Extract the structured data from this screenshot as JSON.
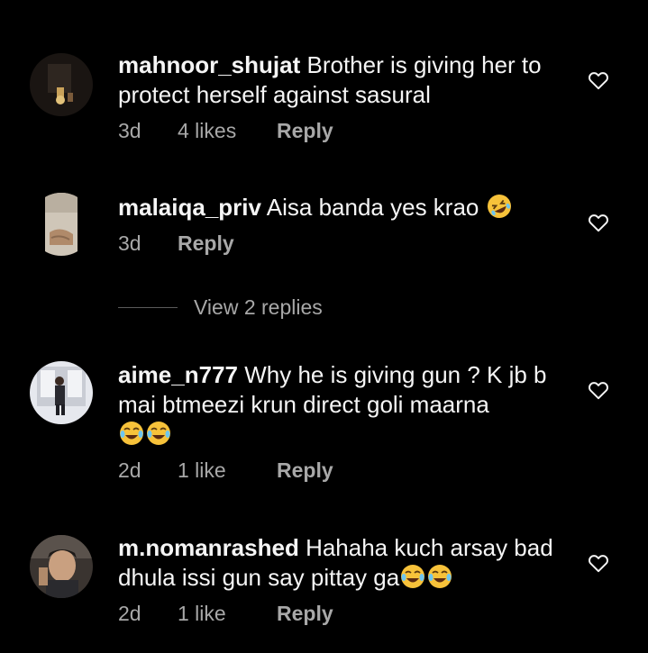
{
  "comments": [
    {
      "username": "mahnoor_shujat",
      "text": "Brother is giving her to protect herself against sasural",
      "time": "3d",
      "likes": "4 likes",
      "reply": "Reply"
    },
    {
      "username": "malaiqa_priv",
      "text": "Aisa banda yes krao",
      "time": "3d",
      "likes": "",
      "reply": "Reply",
      "emoji": "rolling-on-floor-laughing"
    },
    {
      "username": "aime_n777",
      "text": "Why he is giving gun ? K jb b mai btmeezi krun direct goli maarna",
      "time": "2d",
      "likes": "1 like",
      "reply": "Reply",
      "emoji": "face-with-tears-of-joy"
    },
    {
      "username": "m.nomanrashed",
      "text": "Hahaha kuch arsay bad dhula issi gun say pittay ga",
      "time": "2d",
      "likes": "1 like",
      "reply": "Reply",
      "emoji": "face-with-tears-of-joy"
    }
  ],
  "view_replies": "View 2 replies",
  "icons": {
    "like": "heart-outline-icon"
  },
  "colors": {
    "background": "#000000",
    "text": "#f5f5f5",
    "muted": "#a8a8a8"
  }
}
